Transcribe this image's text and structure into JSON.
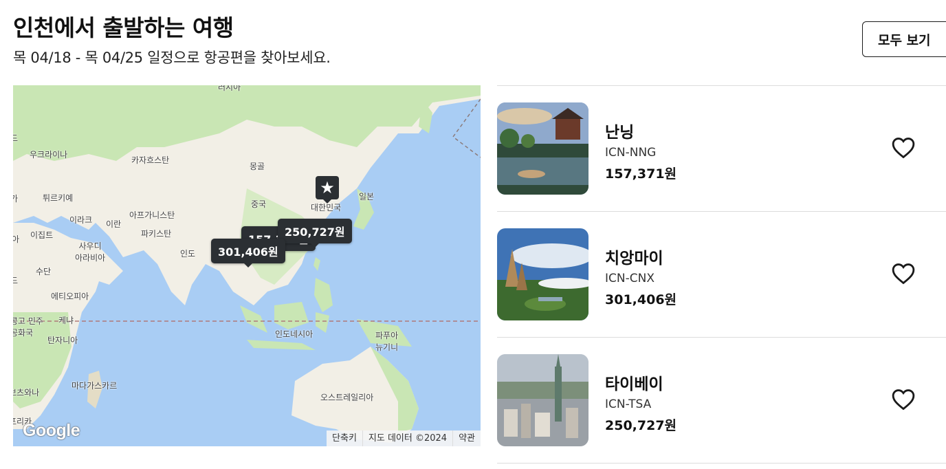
{
  "header": {
    "title": "인천에서 출발하는 여행",
    "subtitle": "목 04/18 - 목 04/25 일정으로 항공편을 찾아보세요.",
    "view_all_label": "모두 보기"
  },
  "map": {
    "labels": {
      "russia": "러시아",
      "ukraine": "우크라이나",
      "kazakhstan": "카자흐스탄",
      "mongolia": "몽골",
      "turkey": "튀르키예",
      "china": "중국",
      "south_korea": "대한민국",
      "japan": "일본",
      "iraq": "이라크",
      "iran": "이란",
      "afghanistan": "아프가니스탄",
      "pakistan": "파키스탄",
      "egypt": "이집트",
      "saudi": "사우디\n아라비아",
      "india": "인도",
      "sudan": "수단",
      "ethiopia": "에티오피아",
      "kenya": "케냐",
      "dr_congo": "콩고 민주\n공화국",
      "tanzania": "탄자니아",
      "indonesia": "인도네시아",
      "papua": "파푸아\n뉴기니",
      "madagascar": "마다가스카르",
      "botswana": "보츠와나",
      "south_africa": "프리카",
      "australia": "오스트레일리아",
      "edge_a": "아",
      "edge_d": "드",
      "edge_d2": "드",
      "edge_d3": "드",
      "edge_ga": "가"
    },
    "pins": {
      "nanning_price": "157,371원",
      "chiangmai_price": "301,406원",
      "taipei_price": "250,727원",
      "origin_icon": "star-icon"
    },
    "logo": "Google",
    "attribution": {
      "shortcuts": "단축키",
      "map_data": "지도 데이터 ©2024",
      "terms": "약관"
    }
  },
  "destinations": [
    {
      "name": "난닝",
      "code": "ICN-NNG",
      "price": "157,371원"
    },
    {
      "name": "치앙마이",
      "code": "ICN-CNX",
      "price": "301,406원"
    },
    {
      "name": "타이베이",
      "code": "ICN-TSA",
      "price": "250,727원"
    }
  ],
  "colors": {
    "pin_bg": "#2b2f33",
    "water": "#a9cdf4",
    "land": "#f2efe6",
    "green": "#c9e6b4"
  }
}
